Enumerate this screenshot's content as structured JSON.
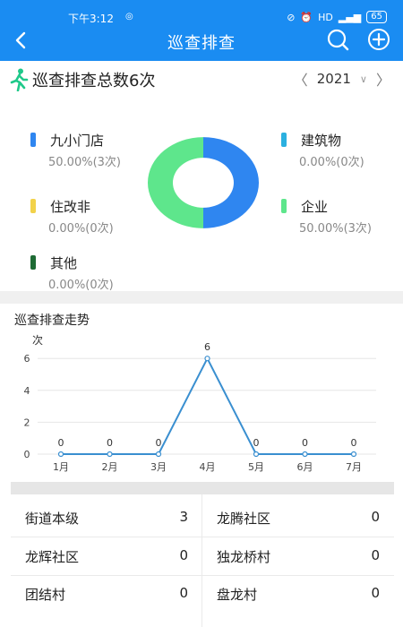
{
  "status_bar": {
    "time": "下午3:12",
    "battery": "65"
  },
  "nav": {
    "title": "巡查排查"
  },
  "summary": {
    "title": "巡查排查总数6次",
    "year": "2021"
  },
  "legend": [
    {
      "name": "九小门店",
      "pct": "50.00%(3次)",
      "color": "#2f86f0"
    },
    {
      "name": "建筑物",
      "pct": "0.00%(0次)",
      "color": "#2bb0e0"
    },
    {
      "name": "住改非",
      "pct": "0.00%(0次)",
      "color": "#f2d24a"
    },
    {
      "name": "企业",
      "pct": "50.00%(3次)",
      "color": "#5ee68c"
    },
    {
      "name": "其他",
      "pct": "0.00%(0次)",
      "color": "#1e6b34"
    }
  ],
  "donut": {
    "values": [
      3,
      3
    ],
    "colors": [
      "#2f86f0",
      "#5ee68c"
    ]
  },
  "trend": {
    "title": "巡查排查走势"
  },
  "chart_data": {
    "type": "line",
    "title": "",
    "ylabel": "次",
    "categories": [
      "1月",
      "2月",
      "3月",
      "4月",
      "5月",
      "6月",
      "7月"
    ],
    "values": [
      0,
      0,
      0,
      6,
      0,
      0,
      0
    ],
    "yticks": [
      "0",
      "2",
      "4",
      "6"
    ],
    "ylim": [
      0,
      6
    ],
    "color": "#3a8fd0"
  },
  "areas": [
    {
      "name": "街道本级",
      "count": "3"
    },
    {
      "name": "龙腾社区",
      "count": "0"
    },
    {
      "name": "龙辉社区",
      "count": "0"
    },
    {
      "name": "独龙桥村",
      "count": "0"
    },
    {
      "name": "团结村",
      "count": "0"
    },
    {
      "name": "盘龙村",
      "count": "0"
    }
  ]
}
